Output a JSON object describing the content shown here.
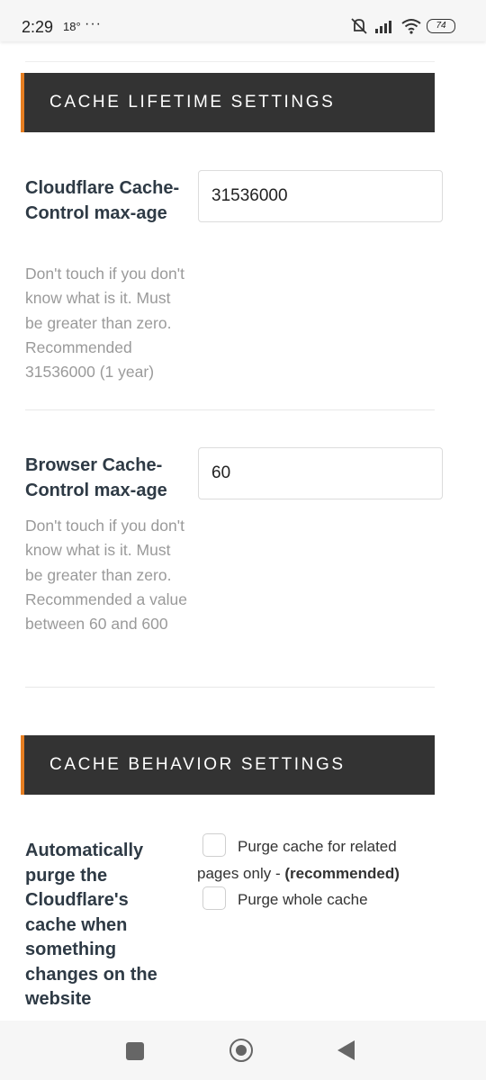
{
  "status_bar": {
    "time": "2:29",
    "temperature": "18°",
    "more": "···",
    "battery": "74"
  },
  "sections": {
    "lifetime": {
      "title": "CACHE LIFETIME SETTINGS"
    },
    "behavior": {
      "title": "CACHE BEHAVIOR SETTINGS"
    }
  },
  "fields": {
    "cf_max_age": {
      "label": "Cloudflare Cache-Control max-age",
      "value": "31536000",
      "description": "Don't touch if you don't know what is it. Must be greater than zero. Recommended 31536000 (1 year)"
    },
    "browser_max_age": {
      "label": "Browser Cache-Control max-age",
      "value": "60",
      "description": "Don't touch if you don't know what is it. Must be greater than zero. Recommended a value between 60 and 600"
    },
    "auto_purge": {
      "label": "Automatically purge the Cloudflare's cache when something changes on the website",
      "option1_text": "Purge cache for related",
      "option1_text_2": "pages only - ",
      "option1_bold": "(recommended)",
      "option2_text": "Purge whole cache"
    }
  },
  "colors": {
    "header_bg": "#333333",
    "accent": "#e67e22"
  }
}
